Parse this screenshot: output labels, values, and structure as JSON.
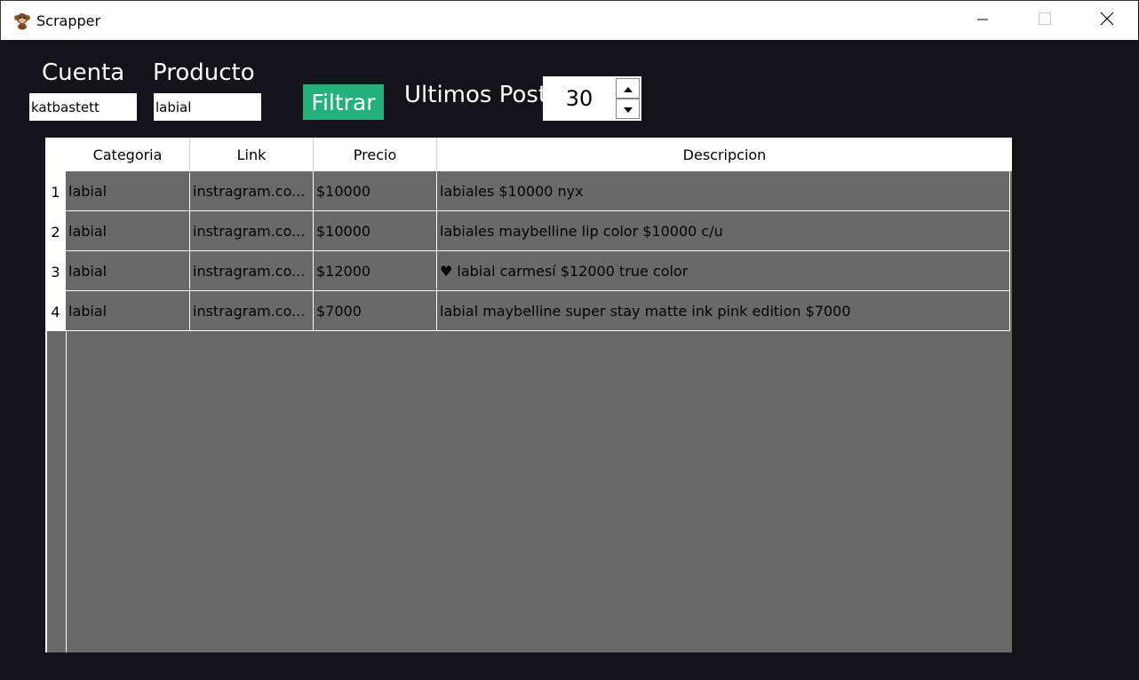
{
  "window": {
    "title": "Scrapper",
    "icon": "monkey-app-icon",
    "controls": [
      "minimize-icon",
      "maximize-icon",
      "close-icon"
    ]
  },
  "filters": {
    "cuenta_label": "Cuenta",
    "cuenta_value": "katbastett",
    "producto_label": "Producto",
    "producto_value": "labial",
    "filtrar_label": "Filtrar",
    "ultimos_label": "Ultimos Post",
    "ultimos_value": "30"
  },
  "colors": {
    "background": "#15131a",
    "button": "#23b07a",
    "grid": "#696969"
  },
  "table": {
    "columns": [
      "Categoria",
      "Link",
      "Precio",
      "Descripcion"
    ],
    "rows": [
      {
        "num": "1",
        "categoria": "labial",
        "link": "instragram.co...",
        "precio": "$10000",
        "descripcion": "labiales $10000 nyx"
      },
      {
        "num": "2",
        "categoria": "labial",
        "link": "instragram.co...",
        "precio": "$10000",
        "descripcion": "labiales maybelline lip color $10000 c/u"
      },
      {
        "num": "3",
        "categoria": "labial",
        "link": "instragram.co...",
        "precio": "$12000",
        "descripcion": "♥ labial carmesí $12000 true color"
      },
      {
        "num": "4",
        "categoria": "labial",
        "link": "instragram.co...",
        "precio": "$7000",
        "descripcion": "labial maybelline super stay matte ink pink edition $7000"
      }
    ]
  }
}
